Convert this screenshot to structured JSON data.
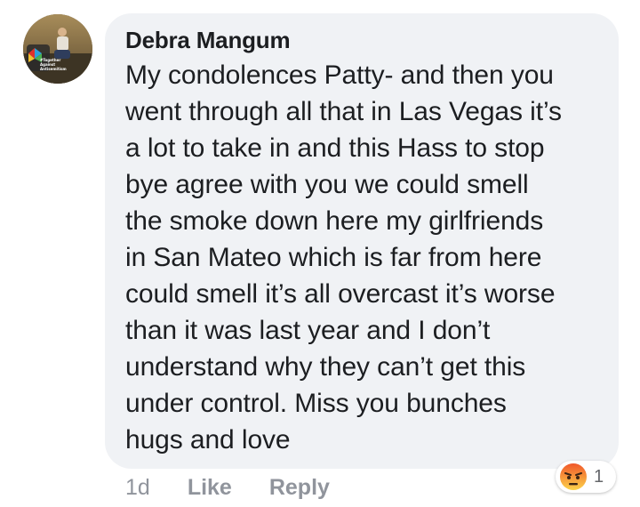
{
  "comment": {
    "author": "Debra Mangum",
    "avatar_caption": "#Together\nAgainst\nAntisemitism",
    "lines": [
      "My condolences Patty- and then you",
      "went through all that in Las Vegas it’s",
      "a lot to take in and this Hass to stop",
      "bye agree with you we could smell",
      "the smoke down here my girlfriends",
      "in San Mateo which is far from here",
      "could smell it’s all overcast it’s worse",
      "than it was last year and I don’t",
      "understand why they can’t get this",
      "under control. Miss you bunches",
      "hugs and love"
    ]
  },
  "actions": {
    "timestamp": "1d",
    "like_label": "Like",
    "reply_label": "Reply"
  },
  "reaction": {
    "icon": "angry-face-icon",
    "count": "1"
  },
  "colors": {
    "bubble_bg": "#f0f2f5",
    "text": "#1c1e21",
    "meta_text": "#90949c",
    "angry_orange": "#e9710f"
  }
}
